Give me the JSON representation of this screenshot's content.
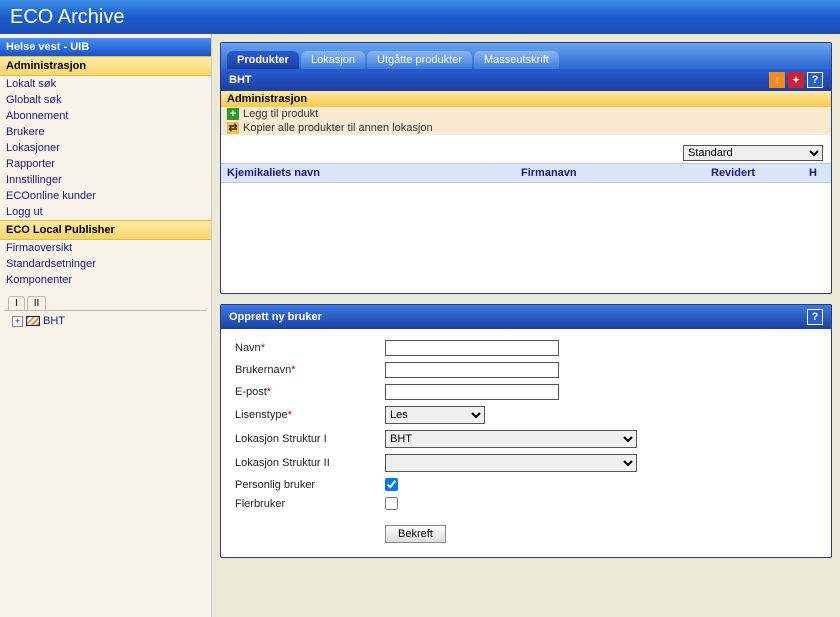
{
  "app": {
    "title": "ECO Archive"
  },
  "sidebar": {
    "header": "Helse vest - UIB",
    "section1": "Administrasjon",
    "items1": [
      "Lokalt søk",
      "Globalt søk",
      "Abonnement",
      "Brukere",
      "Lokasjoner",
      "Rapporter",
      "Innstillinger",
      "ECOonline kunder",
      "Logg ut"
    ],
    "section2": "ECO Local Publisher",
    "items2": [
      "Firmaoversikt",
      "Standardsetninger",
      "Komponenter"
    ],
    "tree_tabs": [
      "I",
      "II"
    ],
    "tree_node": "BHT"
  },
  "tabs": [
    {
      "label": "Produkter",
      "active": true
    },
    {
      "label": "Lokasjon",
      "active": false
    },
    {
      "label": "Utgåtte produkter",
      "active": false
    },
    {
      "label": "Masseutskrift",
      "active": false
    }
  ],
  "product_panel": {
    "title": "BHT",
    "admin_label": "Administrasjon",
    "action_add": "Legg til produkt",
    "action_copy": "Kopier alle produkter til annen lokasjon",
    "filter_options": [
      "Standard"
    ],
    "filter_selected": "Standard",
    "columns": {
      "name": "Kjemikaliets navn",
      "firm": "Firmanavn",
      "rev": "Revidert",
      "h": "H"
    }
  },
  "form": {
    "title": "Opprett ny bruker",
    "labels": {
      "navn": "Navn",
      "brukernavn": "Brukernavn",
      "epost": "E-post",
      "lisenstype": "Lisenstype",
      "struktur1": "Lokasjon Struktur I",
      "struktur2": "Lokasjon Struktur II",
      "personlig": "Personlig bruker",
      "flerbruker": "Flerbruker"
    },
    "values": {
      "navn": "",
      "brukernavn": "",
      "epost": "",
      "lisenstype_options": [
        "Les"
      ],
      "lisenstype_selected": "Les",
      "struktur1_options": [
        "BHT"
      ],
      "struktur1_selected": "BHT",
      "struktur2_options": [
        ""
      ],
      "struktur2_selected": "",
      "personlig_checked": true,
      "flerbruker_checked": false
    },
    "submit": "Bekreft"
  }
}
